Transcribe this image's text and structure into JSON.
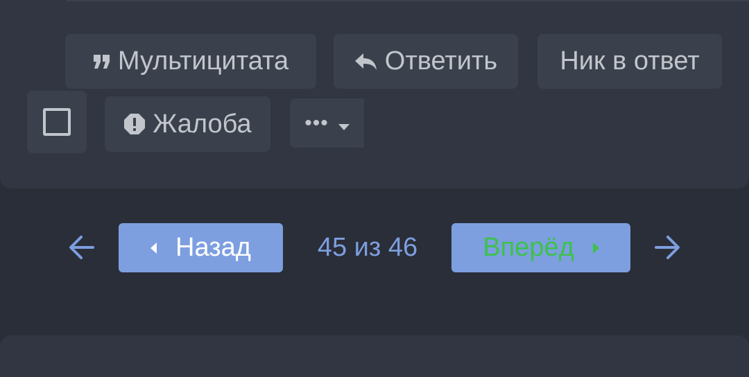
{
  "post_actions": {
    "multiquote_label": "Мультицитата",
    "reply_label": "Ответить",
    "nick_reply_label": "Ник в ответ",
    "report_label": "Жалоба",
    "more_label": "•••"
  },
  "pagination": {
    "back_label": "Назад",
    "forward_label": "Вперёд",
    "counter": "45 из 46"
  },
  "colors": {
    "background": "#2a2e38",
    "card": "#313642",
    "button": "#3b414c",
    "button_text": "#c2c6cc",
    "accent": "#7d9fe0",
    "forward_text": "#3dc14d"
  },
  "icons": {
    "multiquote": "quote-icon",
    "reply": "reply-arrow-icon",
    "report": "alert-octagon-icon",
    "more": "chevron-down-icon",
    "checkbox": "checkbox-empty-icon",
    "prev": "arrow-left-icon",
    "next": "arrow-right-icon"
  }
}
